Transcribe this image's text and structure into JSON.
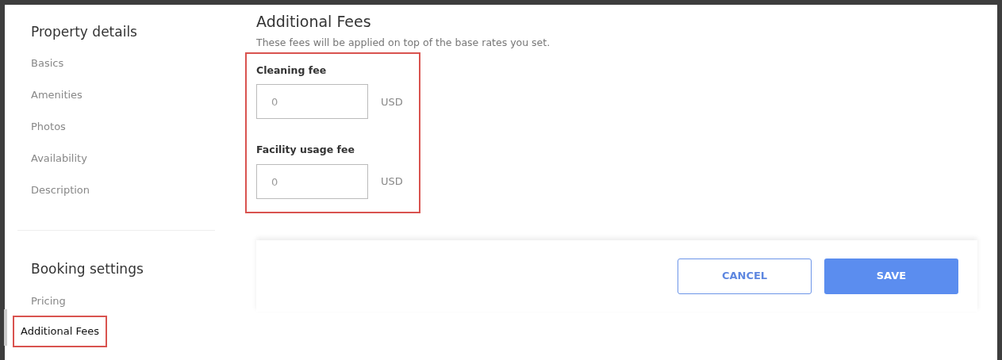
{
  "sidebar": {
    "sections": [
      {
        "title": "Property details",
        "items": [
          {
            "label": "Basics",
            "selected": false,
            "highlighted": false
          },
          {
            "label": "Amenities",
            "selected": false,
            "highlighted": false
          },
          {
            "label": "Photos",
            "selected": false,
            "highlighted": false
          },
          {
            "label": "Availability",
            "selected": false,
            "highlighted": false
          },
          {
            "label": "Description",
            "selected": false,
            "highlighted": false
          }
        ]
      },
      {
        "title": "Booking settings",
        "items": [
          {
            "label": "Pricing",
            "selected": false,
            "highlighted": false
          },
          {
            "label": "Additional Fees",
            "selected": true,
            "highlighted": true
          }
        ]
      }
    ]
  },
  "content": {
    "title": "Additional Fees",
    "description": "These fees will be applied on top of the base rates you set.",
    "fields_highlighted": true,
    "fields": [
      {
        "label": "Cleaning fee",
        "placeholder": "0",
        "unit": "USD"
      },
      {
        "label": "Facility usage fee",
        "placeholder": "0",
        "unit": "USD"
      }
    ]
  },
  "footer": {
    "buttons": [
      {
        "label": "CANCEL",
        "kind": "secondary"
      },
      {
        "label": "SAVE",
        "kind": "primary"
      }
    ]
  }
}
